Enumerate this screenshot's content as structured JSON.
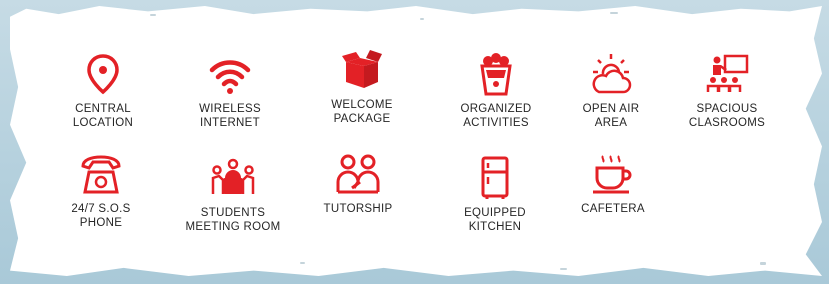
{
  "accent_color": "#e32126",
  "features": [
    {
      "label": "CENTRAL\nLOCATION",
      "icon": "location-pin-icon"
    },
    {
      "label": "WIRELESS\nINTERNET",
      "icon": "wifi-icon"
    },
    {
      "label": "WELCOME\nPACKAGE",
      "icon": "open-box-icon"
    },
    {
      "label": "ORGANIZED\nACTIVITIES",
      "icon": "popcorn-icon"
    },
    {
      "label": "OPEN AIR\nAREA",
      "icon": "sun-cloud-icon"
    },
    {
      "label": "SPACIOUS\nCLASROOMS",
      "icon": "classroom-icon"
    },
    {
      "label": "24/7 S.O.S\nPHONE",
      "icon": "telephone-icon"
    },
    {
      "label": "STUDENTS\nMEETING ROOM",
      "icon": "meeting-room-icon"
    },
    {
      "label": "TUTORSHIP",
      "icon": "tutorship-icon"
    },
    {
      "label": "EQUIPPED\nKITCHEN",
      "icon": "refrigerator-icon"
    },
    {
      "label": "CAFETERA",
      "icon": "coffee-cup-icon"
    }
  ]
}
